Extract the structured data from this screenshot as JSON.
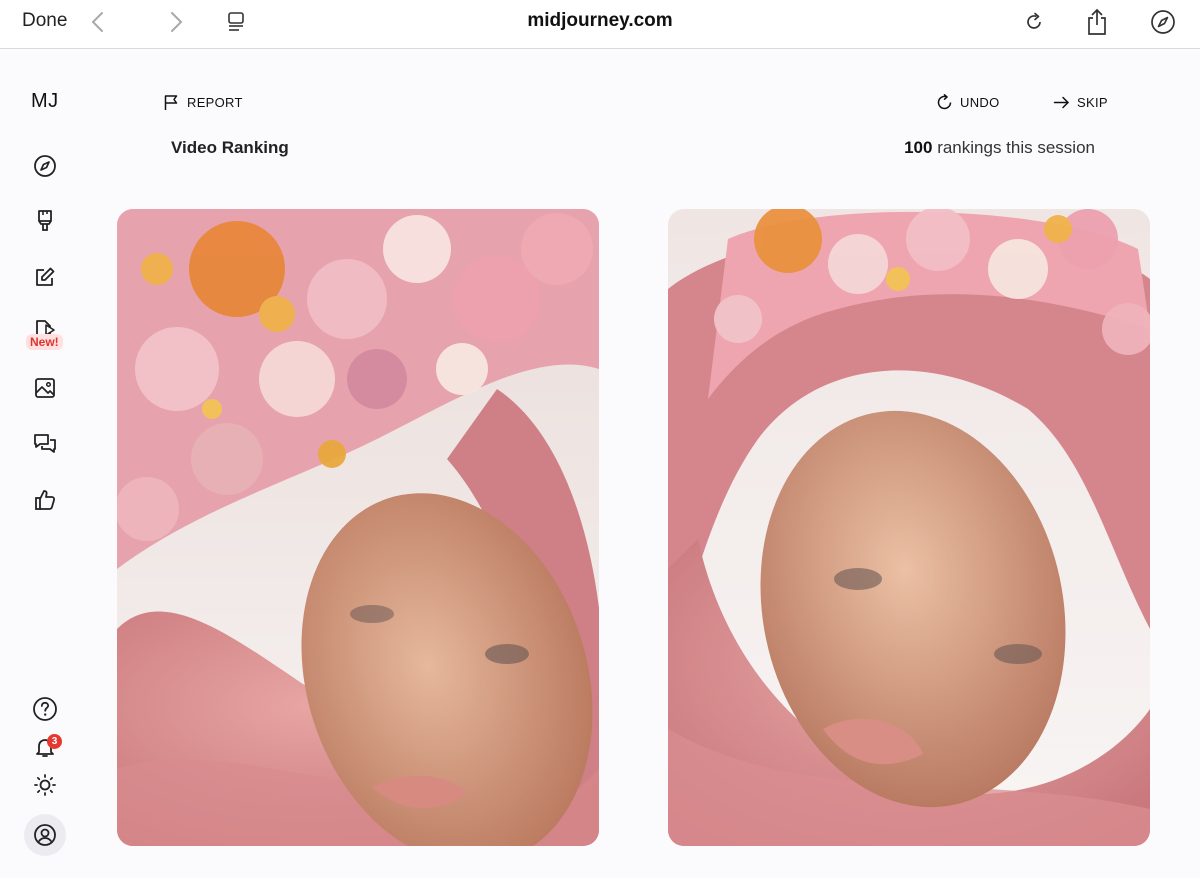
{
  "browser": {
    "done_label": "Done",
    "url": "midjourney.com"
  },
  "sidebar": {
    "logo": "MJ",
    "new_badge": "New!",
    "notification_count": "3",
    "icons": [
      "explore-icon",
      "brush-icon",
      "edit-icon",
      "video-icon",
      "image-icon",
      "chat-icon",
      "thumbs-up-icon",
      "help-icon",
      "bell-icon",
      "sun-icon",
      "profile-icon"
    ]
  },
  "header": {
    "report_label": "REPORT",
    "undo_label": "UNDO",
    "skip_label": "SKIP",
    "title": "Video Ranking",
    "session_count": "100",
    "session_label": "rankings this session"
  },
  "colors": {
    "accent_pink": "#d98a8a",
    "badge_red": "#e6382e"
  }
}
